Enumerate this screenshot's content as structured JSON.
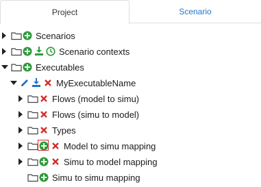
{
  "tabs": {
    "project": "Project",
    "scenario": "Scenario"
  },
  "tree": {
    "scenarios": "Scenarios",
    "scenario_contexts": "Scenario contexts",
    "executables": "Executables",
    "executable_name": "MyExecutableName",
    "flows_model_to_simu": "Flows (model to simu)",
    "flows_simu_to_model": "Flows (simu to model)",
    "types": "Types",
    "model_to_simu_mapping": "Model to simu mapping",
    "simu_to_model_mapping": "Simu to model mapping",
    "simu_to_simu_mapping": "Simu to simu mapping"
  },
  "colors": {
    "add": "#2e9b3a",
    "delete": "#d62b2b",
    "edit": "#1f74c8",
    "tab_active_text": "#333333",
    "tab_inactive_text": "#1f74c8"
  }
}
